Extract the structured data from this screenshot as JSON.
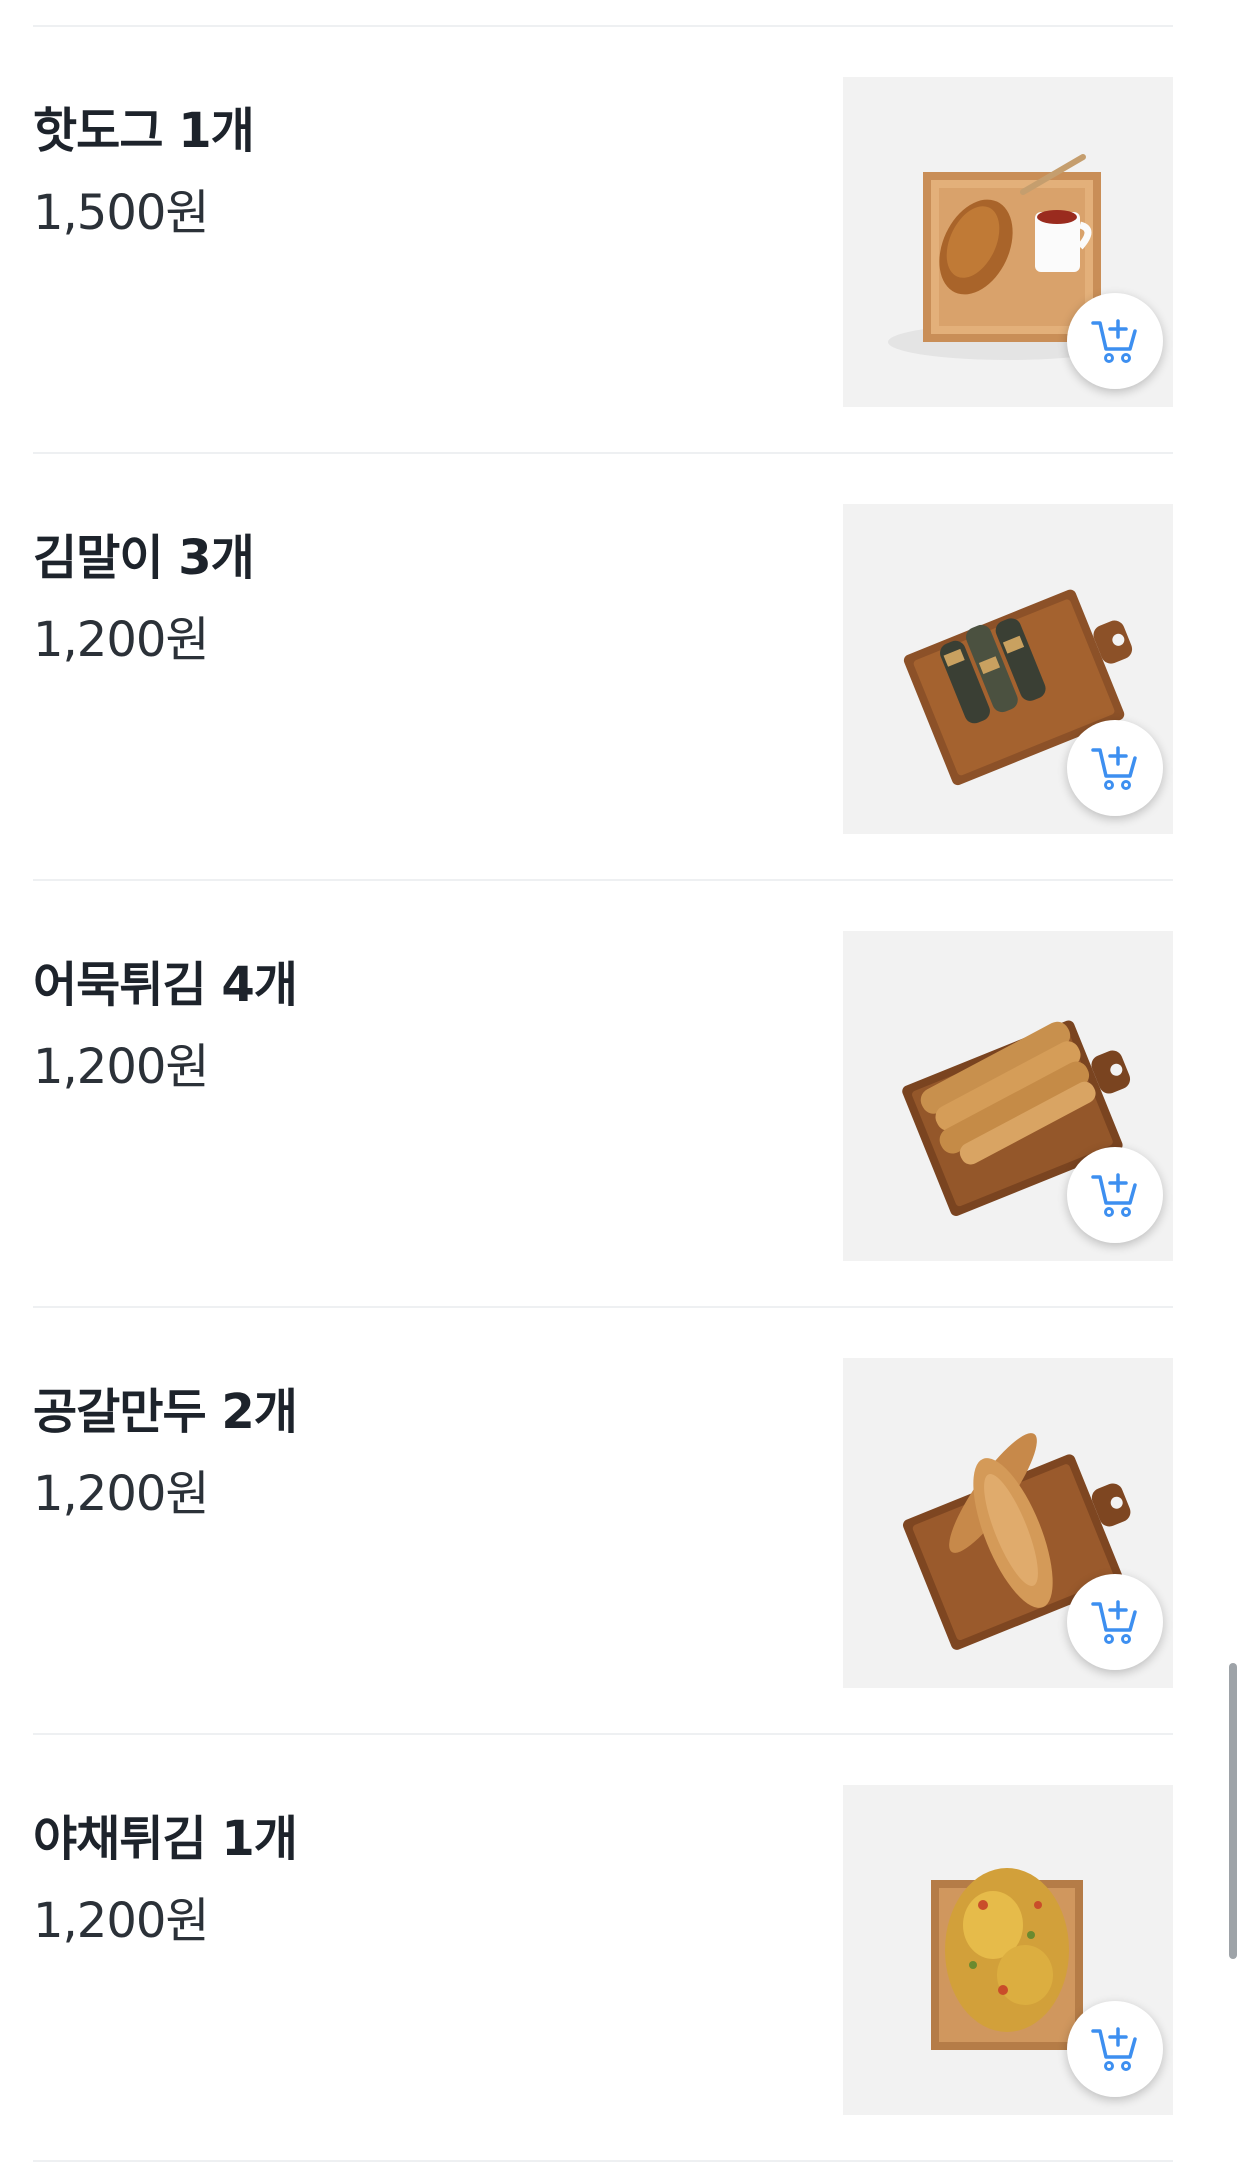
{
  "menu_items": [
    {
      "name": "핫도그 1개",
      "price": "1,500원",
      "image": "hotdog-photo",
      "cart_icon": "add-to-cart-icon"
    },
    {
      "name": "김말이 3개",
      "price": "1,200원",
      "image": "gimmari-photo",
      "cart_icon": "add-to-cart-icon"
    },
    {
      "name": "어묵튀김 4개",
      "price": "1,200원",
      "image": "fishcake-fritter-photo",
      "cart_icon": "add-to-cart-icon"
    },
    {
      "name": "공갈만두 2개",
      "price": "1,200원",
      "image": "hollow-dumpling-photo",
      "cart_icon": "add-to-cart-icon"
    },
    {
      "name": "야채튀김 1개",
      "price": "1,200원",
      "image": "vegetable-fritter-photo",
      "cart_icon": "add-to-cart-icon"
    }
  ],
  "colors": {
    "text_primary": "#1d232b",
    "divider": "#eef0f2",
    "cart_icon": "#3d8ff0",
    "photo_background": "#f1f1f1"
  }
}
